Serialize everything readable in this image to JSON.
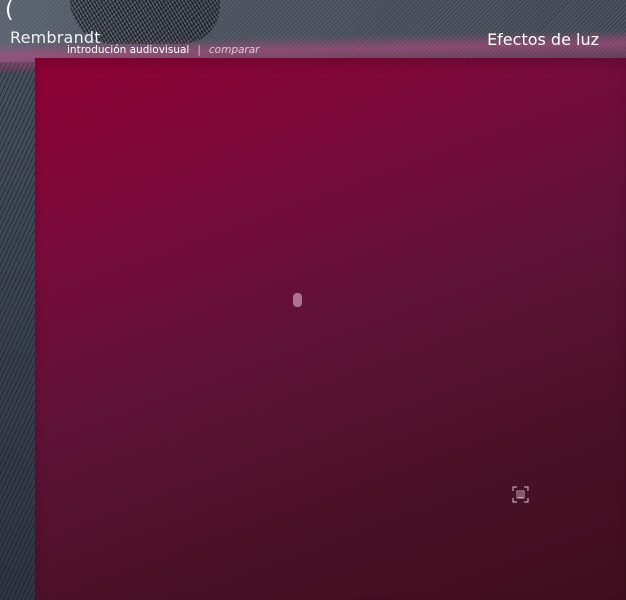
{
  "header": {
    "bracket": "(",
    "brand": "Rembrandt",
    "section_title": "Efectos de luz"
  },
  "nav": {
    "items": [
      {
        "label": "introdución audiovisual",
        "active": true
      },
      {
        "label": "comparar",
        "active": false
      }
    ],
    "separator": "|"
  },
  "icons": {
    "loader": "loading-indicator-icon",
    "fullscreen": "fullscreen-icon"
  },
  "colors": {
    "stage_top": "#8e0234",
    "stage_bottom": "#3f0e1e",
    "header": "#4a515c",
    "text": "#ffffff"
  }
}
